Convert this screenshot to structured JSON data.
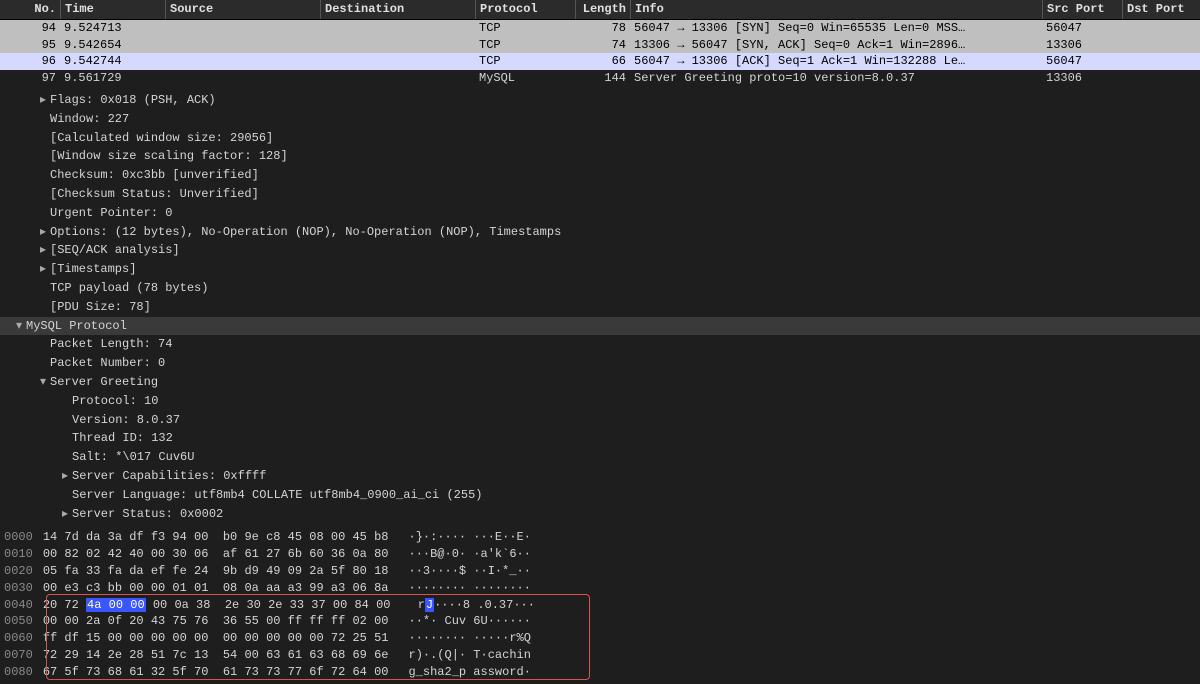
{
  "columns": {
    "no": "No.",
    "time": "Time",
    "src": "Source",
    "dst": "Destination",
    "proto": "Protocol",
    "len": "Length",
    "info": "Info",
    "sport": "Src Port",
    "dport": "Dst Port"
  },
  "packets": [
    {
      "cls": "c-grey",
      "no": "94",
      "time": "9.524713",
      "src": "",
      "dst": "",
      "proto": "TCP",
      "len": "78",
      "info": "56047 → 13306 [SYN] Seq=0 Win=65535 Len=0 MSS…",
      "sport": "56047",
      "dport": ""
    },
    {
      "cls": "c-grey",
      "no": "95",
      "time": "9.542654",
      "src": "",
      "dst": "",
      "proto": "TCP",
      "len": "74",
      "info": "13306 → 56047 [SYN, ACK] Seq=0 Ack=1 Win=2896…",
      "sport": "13306",
      "dport": ""
    },
    {
      "cls": "c-blue",
      "no": "96",
      "time": "9.542744",
      "src": "",
      "dst": "",
      "proto": "TCP",
      "len": "66",
      "info": "56047 → 13306 [ACK] Seq=1 Ack=1 Win=132288 Le…",
      "sport": "56047",
      "dport": ""
    },
    {
      "cls": "c-dark",
      "no": "97",
      "time": "9.561729",
      "src": "",
      "dst": "",
      "proto": "MySQL",
      "len": "144",
      "info": "Server Greeting proto=10 version=8.0.37",
      "sport": "13306",
      "dport": ""
    }
  ],
  "detail": {
    "tcp": {
      "flags": "Flags: 0x018 (PSH, ACK)",
      "window": "Window: 227",
      "calc_win": "[Calculated window size: 29056]",
      "win_scale": "[Window size scaling factor: 128]",
      "checksum": "Checksum: 0xc3bb [unverified]",
      "checksum_status": "[Checksum Status: Unverified]",
      "urgent": "Urgent Pointer: 0",
      "options": "Options: (12 bytes), No-Operation (NOP), No-Operation (NOP), Timestamps",
      "seq_ack": "[SEQ/ACK analysis]",
      "timestamps": "[Timestamps]",
      "payload": "TCP payload (78 bytes)",
      "pdu": "[PDU Size: 78]"
    },
    "mysql_hdr": "MySQL Protocol",
    "mysql": {
      "pkt_len": "Packet Length: 74",
      "pkt_num": "Packet Number: 0",
      "server_greeting": "Server Greeting",
      "proto": "Protocol: 10",
      "version": "Version: 8.0.37",
      "thread": "Thread ID: 132",
      "salt": "Salt: *\\017 Cuv6U",
      "caps": "Server Capabilities: 0xffff",
      "lang": "Server Language: utf8mb4 COLLATE utf8mb4_0900_ai_ci (255)",
      "status": "Server Status: 0x0002"
    }
  },
  "hex": [
    {
      "off": "0000",
      "b1": "14 7d da 3a df f3 94 00",
      "b2": "b0 9e c8 45 08 00 45 b8",
      "asc": "·}·:···· ···E··E·"
    },
    {
      "off": "0010",
      "b1": "00 82 02 42 40 00 30 06",
      "b2": "af 61 27 6b 60 36 0a 80",
      "asc": "···B@·0· ·a'k`6··"
    },
    {
      "off": "0020",
      "b1": "05 fa 33 fa da ef fe 24",
      "b2": "9b d9 49 09 2a 5f 80 18",
      "asc": "··3····$ ··I·*_··"
    },
    {
      "off": "0030",
      "b1": "00 e3 c3 bb 00 00 01 01",
      "b2": "08 0a aa a3 99 a3 06 8a",
      "asc": "········ ········"
    },
    {
      "off": "0040",
      "b1": "20 72 4a 00 00 00 0a 38",
      "b2": "2e 30 2e 33 37 00 84 00",
      "asc": " rJ····8 .0.37···",
      "hl": true
    },
    {
      "off": "0050",
      "b1": "00 00 2a 0f 20 43 75 76",
      "b2": "36 55 00 ff ff ff 02 00",
      "asc": "··*· Cuv 6U······"
    },
    {
      "off": "0060",
      "b1": "ff df 15 00 00 00 00 00",
      "b2": "00 00 00 00 00 72 25 51",
      "asc": "········ ·····r%Q"
    },
    {
      "off": "0070",
      "b1": "72 29 14 2e 28 51 7c 13",
      "b2": "54 00 63 61 63 68 69 6e",
      "asc": "r)·.(Q|· T·cachin"
    },
    {
      "off": "0080",
      "b1": "67 5f 73 68 61 32 5f 70",
      "b2": "61 73 73 77 6f 72 64 00",
      "asc": "g_sha2_p assword·"
    }
  ]
}
